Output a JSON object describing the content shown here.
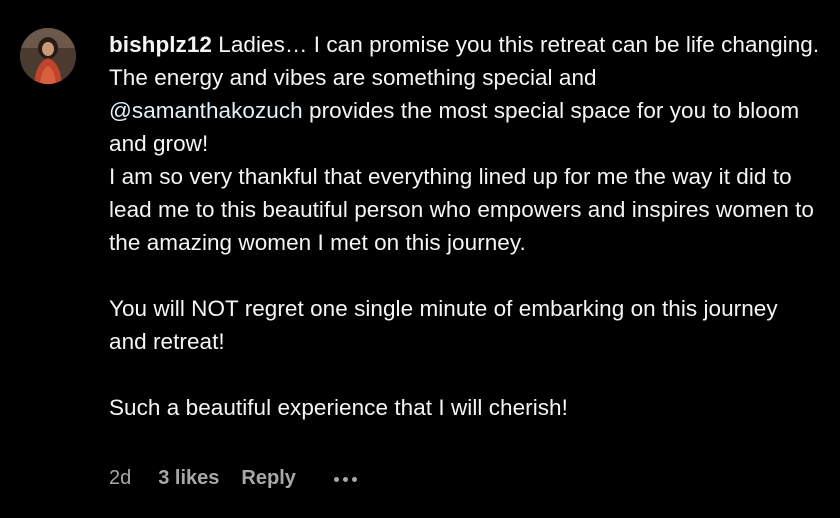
{
  "comment": {
    "username": "bishplz12",
    "intro": "Ladies… I can promise you this retreat can be life changing.",
    "line2": "The energy and vibes are something special and",
    "mention": "@samanthakozuch",
    "line2_after": "provides the most special space for you to bloom and grow!",
    "line3": "I am so very thankful that everything lined up for me the way it did to lead me to this beautiful person who empowers and inspires women to the amazing women I met on this journey.",
    "para2": "You will NOT regret one single minute of embarking on this journey and retreat!",
    "para3": "Such a beautiful experience that I will cherish!"
  },
  "footer": {
    "time": "2d",
    "likes": "3 likes",
    "reply": "Reply",
    "more_icon": "ellipsis-icon"
  },
  "colors": {
    "background": "#000000",
    "text": "#f5f5f5",
    "mention": "#e0f1ff",
    "muted": "#a8a8a8"
  }
}
